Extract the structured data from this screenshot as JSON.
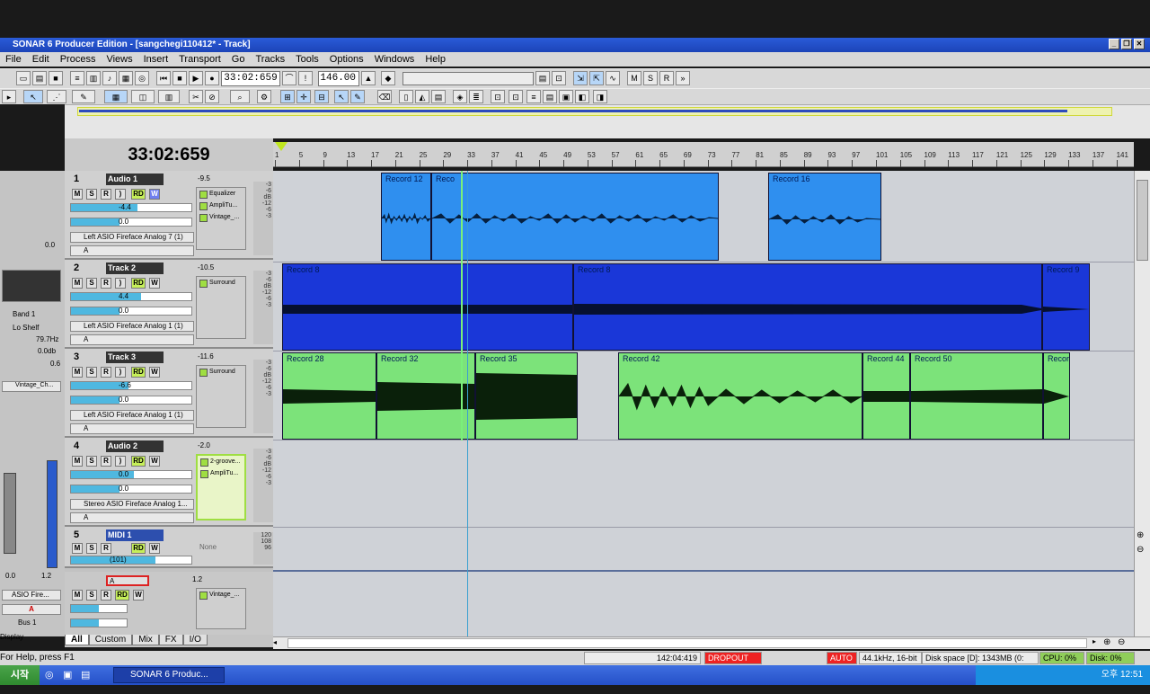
{
  "window": {
    "title": "SONAR 6 Producer Edition - [sangchegi110412* - Track]"
  },
  "menu": [
    "File",
    "Edit",
    "Process",
    "Views",
    "Insert",
    "Transport",
    "Go",
    "Tracks",
    "Tools",
    "Options",
    "Windows",
    "Help"
  ],
  "transport": {
    "now_time": "33:02:659",
    "tempo": "146.00"
  },
  "big_time": "33:02:659",
  "ruler_ticks": [
    "1",
    "5",
    "9",
    "13",
    "17",
    "21",
    "25",
    "29",
    "33",
    "37",
    "41",
    "45",
    "49",
    "53",
    "57",
    "61",
    "65",
    "69",
    "73",
    "77",
    "81",
    "85",
    "89",
    "93",
    "97",
    "101",
    "105",
    "109",
    "113",
    "117",
    "121",
    "125",
    "129",
    "133",
    "137",
    "141"
  ],
  "tracks": [
    {
      "num": "1",
      "name": "Audio 1",
      "vol": "-9.5",
      "fader_val": "-4.4",
      "pan_val": "0.0",
      "output": "Left ASIO Fireface Analog 7 (1)",
      "input": "A",
      "fx": [
        "Equalizer",
        "AmpliTu...",
        "Vintage_..."
      ]
    },
    {
      "num": "2",
      "name": "Track 2",
      "vol": "-10.5",
      "fader_val": "4.4",
      "pan_val": "0.0",
      "output": "Left ASIO Fireface Analog 1 (1)",
      "input": "A",
      "fx": [
        "Surround"
      ]
    },
    {
      "num": "3",
      "name": "Track 3",
      "vol": "-11.6",
      "fader_val": "-6.6",
      "pan_val": "0.0",
      "output": "Left ASIO Fireface Analog 1 (1)",
      "input": "A",
      "fx": [
        "Surround"
      ]
    },
    {
      "num": "4",
      "name": "Audio 2",
      "vol": "-2.0",
      "fader_val": "0.0",
      "pan_val": "0.0",
      "output": "Stereo ASIO Fireface Analog 1...",
      "input": "A",
      "fx": [
        "2-groove...",
        "AmpliTu..."
      ]
    },
    {
      "num": "5",
      "name": "MIDI 1",
      "vol": "",
      "fader_val": "(101)",
      "pan_val": "",
      "output": "",
      "input": "",
      "fx": [
        "None"
      ]
    }
  ],
  "bus": {
    "name": "A",
    "vol": "1.2",
    "fx": [
      "Vintage_..."
    ]
  },
  "left_panel": {
    "val1": "0.0",
    "eq_band": "Band 1",
    "eq_type": "Lo Shelf",
    "freq": "79.7Hz",
    "gain": "0.0db",
    "q": "0.6",
    "plugin": "Vintage_Ch...",
    "out": "ASIO Fire...",
    "in": "A",
    "bus": "Bus 1",
    "display": "Display",
    "fader_l": "0.0",
    "fader_r": "1.2"
  },
  "clips": [
    {
      "label": "Record 12"
    },
    {
      "label": "Reco"
    },
    {
      "label": "Record 16"
    },
    {
      "label": "Record 8"
    },
    {
      "label": "Record 8"
    },
    {
      "label": "Record 9"
    },
    {
      "label": "Record 28"
    },
    {
      "label": "Record 32"
    },
    {
      "label": "Record 35"
    },
    {
      "label": "Record 42"
    },
    {
      "label": "Record 44"
    },
    {
      "label": "Record 50"
    },
    {
      "label": "Recor"
    }
  ],
  "tabs": [
    "All",
    "Custom",
    "Mix",
    "FX",
    "I/O"
  ],
  "status": {
    "help": "For Help, press F1",
    "pos": "142:04:419",
    "dropout": "DROPOUT",
    "auto": "AUTO",
    "format": "44.1kHz, 16-bit",
    "disk": "Disk space [D]: 1343MB (0:",
    "cpu": "CPU: 0%",
    "diskpct": "Disk: 0%"
  },
  "taskbar": {
    "start": "시작",
    "item": "SONAR 6 Produc...",
    "time": "오후 12:51"
  },
  "colors": {
    "blue_clip": "#2f8fef",
    "darkblue_clip": "#1a37d8",
    "green_clip": "#7ce37a",
    "titlebar": "#1c44b8"
  }
}
